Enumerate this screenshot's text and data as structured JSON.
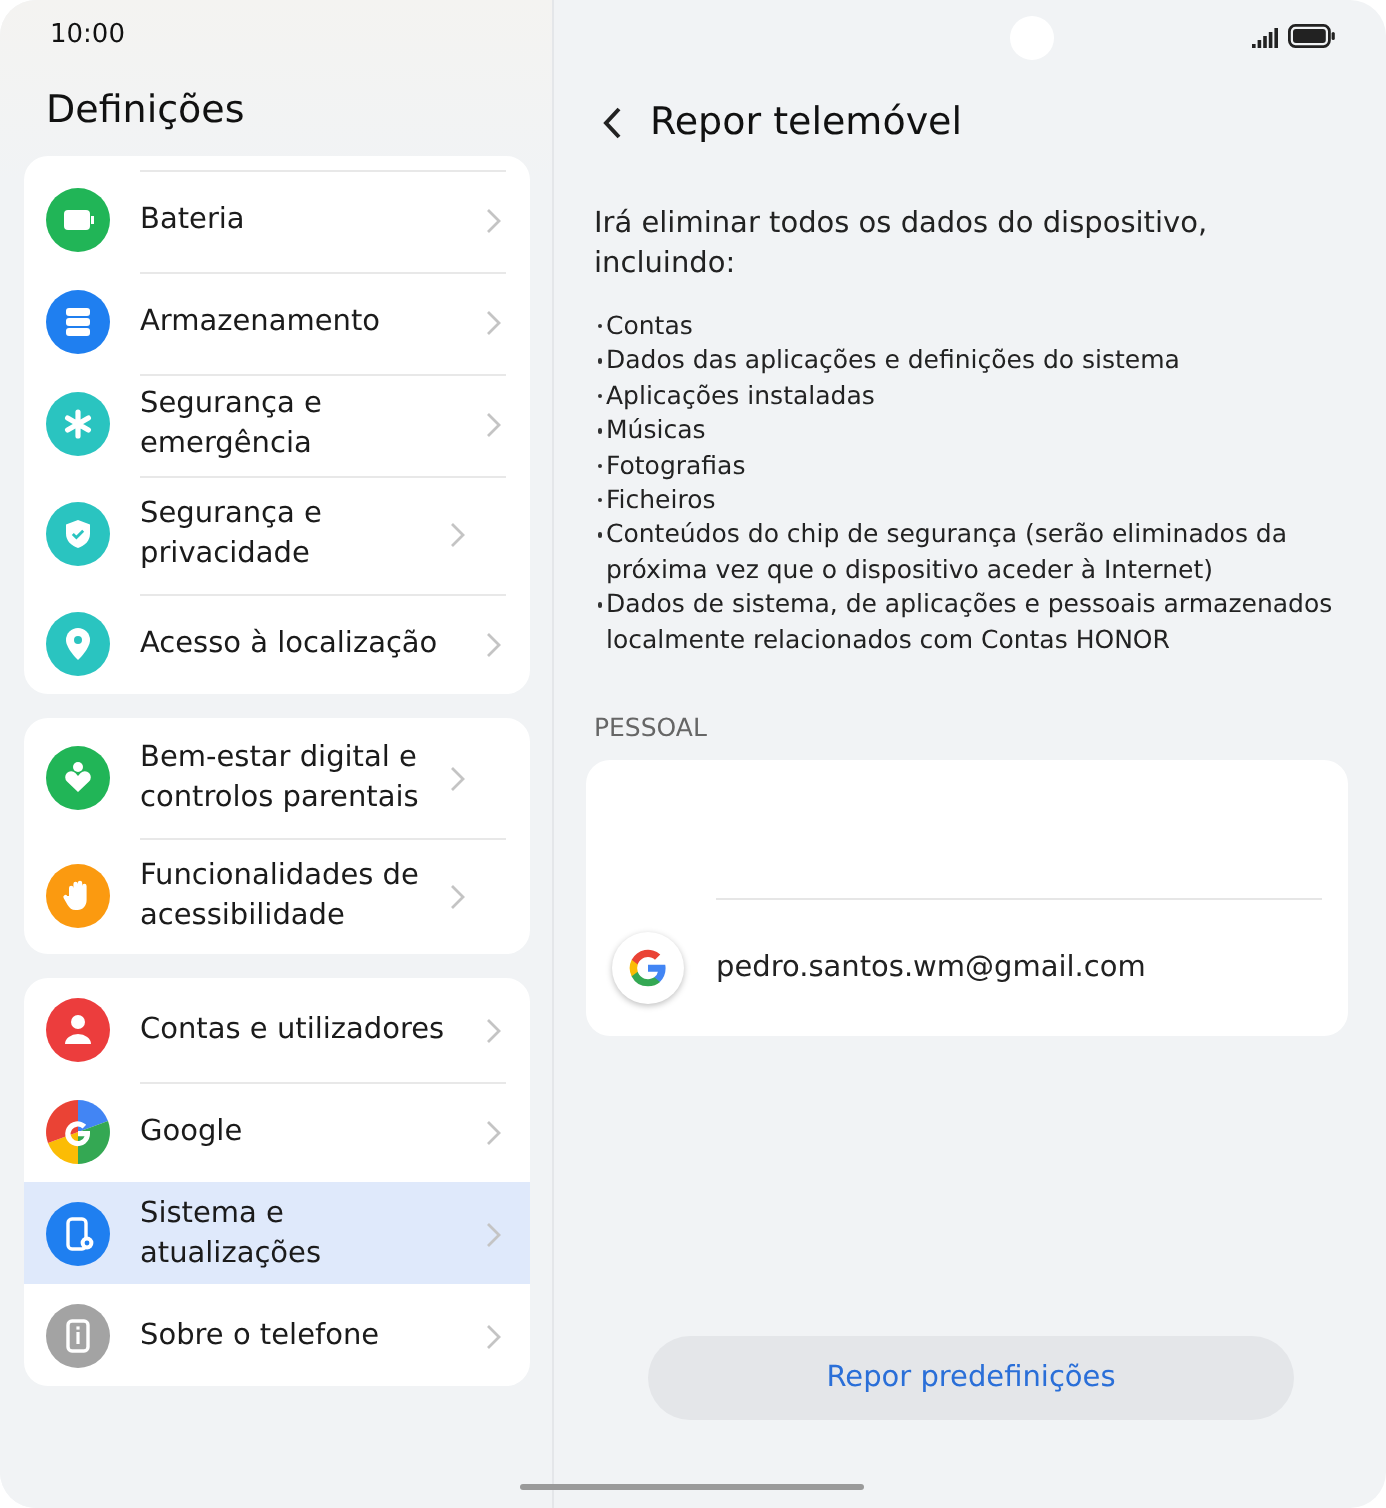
{
  "status_bar": {
    "time": "10:00"
  },
  "sidebar": {
    "title": "Definições",
    "groups": [
      {
        "items": [
          {
            "label": "Bateria",
            "kind": "battery",
            "color": "#21b557",
            "selected": false
          },
          {
            "label": "Armazenamento",
            "kind": "storage",
            "color": "#1f7ff0",
            "selected": false
          },
          {
            "label": "Segurança e emergência",
            "kind": "asterisk",
            "color": "#2ac4c0",
            "selected": false
          },
          {
            "label": "Segurança e privacidade",
            "kind": "shield",
            "color": "#2ac4c0",
            "selected": false
          },
          {
            "label": "Acesso à localização",
            "kind": "pin",
            "color": "#2ac4c0",
            "selected": false
          }
        ]
      },
      {
        "items": [
          {
            "label": "Bem-estar digital e controlos parentais",
            "kind": "wellbeing",
            "color": "#21b557",
            "selected": false
          },
          {
            "label": "Funcionalidades de acessibilidade",
            "kind": "hand",
            "color": "#fb9a10",
            "selected": false
          }
        ]
      },
      {
        "items": [
          {
            "label": "Contas e utilizadores",
            "kind": "person",
            "color": "#ec3d3d",
            "selected": false
          },
          {
            "label": "Google",
            "kind": "google",
            "selected": false
          },
          {
            "label": "Sistema e atualizações",
            "kind": "system",
            "color": "#1f7ff0",
            "selected": true
          },
          {
            "label": "Sobre o telefone",
            "kind": "info",
            "color": "#a3a3a3",
            "selected": false
          }
        ]
      }
    ]
  },
  "detail": {
    "title": "Repor telemóvel",
    "intro": "Irá eliminar todos os dados do dispositivo, incluindo:",
    "bullets": [
      "Contas",
      "Dados das aplicações e definições do sistema",
      "Aplicações instaladas",
      "Músicas",
      "Fotografias",
      "Ficheiros",
      "Conteúdos do chip de segurança (serão eliminados da próxima vez que o dispositivo aceder à Internet)",
      "Dados de sistema, de aplicações e pessoais armazenados localmente relacionados com Contas HONOR"
    ],
    "section": "PESSOAL",
    "accounts": [
      {
        "email": "pedro.santos.wm@gmail.com"
      }
    ],
    "button": "Repor predefinições"
  }
}
